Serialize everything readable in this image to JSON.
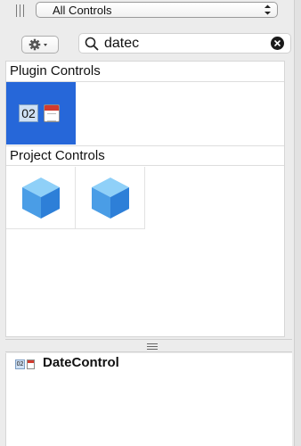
{
  "toolbar": {
    "filter_select": {
      "value": "All Controls",
      "icon": "up-down-arrows-icon"
    },
    "sidebar_toggle_icon": "vertical-bars-icon"
  },
  "search": {
    "action_menu_icon": "gear-menu-icon",
    "search_icon": "magnifier-icon",
    "value": "datec",
    "clear_icon": "clear-circle-icon"
  },
  "library": {
    "sections": [
      {
        "label": "Plugin Controls",
        "items": [
          {
            "icon": "date-control-icon",
            "date_text": "02",
            "selected": true
          }
        ]
      },
      {
        "label": "Project Controls",
        "items": [
          {
            "icon": "cube-icon"
          },
          {
            "icon": "cube-icon"
          }
        ]
      }
    ]
  },
  "inspector": {
    "icon": "date-control-icon",
    "icon_text": "02",
    "title": "DateControl"
  },
  "colors": {
    "selection": "#2667d9",
    "cube_light": "#7cc0f4",
    "cube_dark": "#2d7fd8",
    "calendar_red": "#d23b2e"
  }
}
